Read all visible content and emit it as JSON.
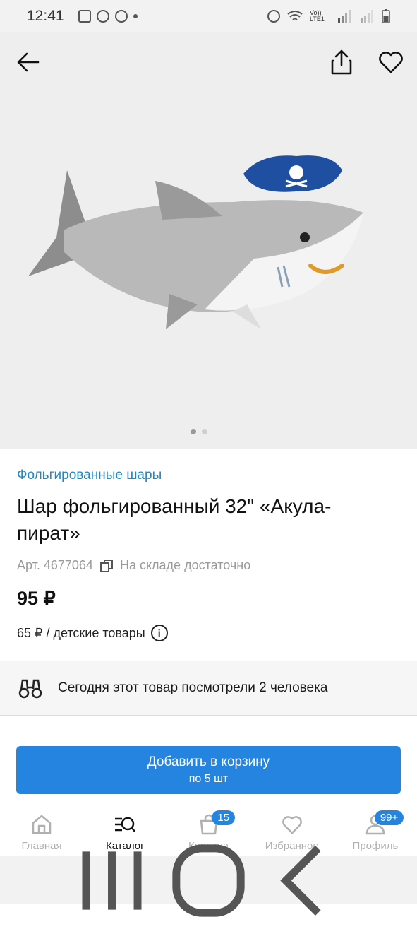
{
  "status_bar": {
    "time": "12:41",
    "volte": "Vo)) LTE1"
  },
  "product": {
    "category": "Фольгированные шары",
    "title": "Шар фольгированный 32\" «Акула-пират»",
    "article": "Арт. 4677064",
    "stock": "На складе достаточно",
    "price": "95 ₽",
    "wholesale": "65 ₽ / детские товары",
    "viewers": "Сегодня этот товар посмотрели 2 человека"
  },
  "cart_button": {
    "label": "Добавить в корзину",
    "sublabel": "по 5 шт"
  },
  "nav": {
    "home": "Главная",
    "catalog": "Каталог",
    "cart": "Корзина",
    "cart_badge": "15",
    "favorites": "Избранное",
    "profile": "Профиль",
    "profile_badge": "99+"
  },
  "colors": {
    "accent": "#2484e0",
    "category_link": "#1e88c8"
  },
  "pager": {
    "total": 2,
    "current": 1
  }
}
